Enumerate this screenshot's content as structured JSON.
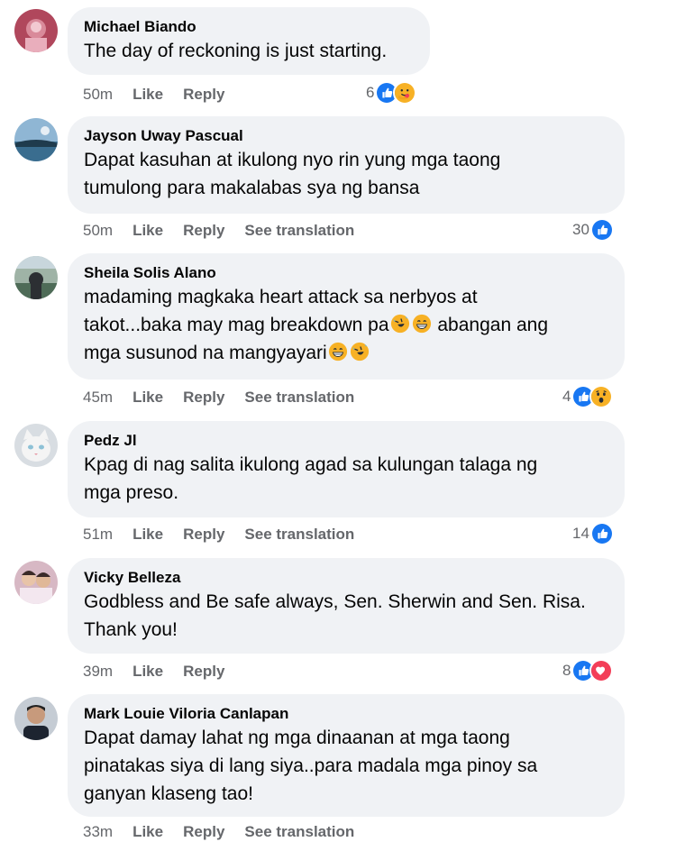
{
  "colors": {
    "bubble": "#f0f2f5",
    "meta_text": "#65676b",
    "like_blue": "#1877f2",
    "love_red": "#f33e58",
    "haha_yellow": "#f7b125"
  },
  "comments": [
    {
      "author": "Michael Biando",
      "text": "The day of reckoning is just starting.",
      "time": "50m",
      "like_label": "Like",
      "reply_label": "Reply",
      "reaction_count": "6",
      "reactions": [
        "like-icon",
        "care-icon"
      ]
    },
    {
      "author": "Jayson Uway Pascual",
      "line1": "Dapat kasuhan at ikulong nyo rin yung mga taong",
      "line2": "tumulong para makalabas sya ng bansa",
      "time": "50m",
      "like_label": "Like",
      "reply_label": "Reply",
      "translate_label": "See translation",
      "reaction_count": "30",
      "reactions": [
        "like-icon"
      ]
    },
    {
      "author": "Sheila Solis Alano",
      "line1": "madaming magkaka heart attack sa nerbyos at",
      "line2a": "takot...baka may mag breakdown pa",
      "line3a": "abangan ang",
      "line3b": "mga susunod na mangyayari",
      "time": "45m",
      "like_label": "Like",
      "reply_label": "Reply",
      "translate_label": "See translation",
      "reaction_count": "4",
      "reactions": [
        "like-icon",
        "wow-icon"
      ]
    },
    {
      "author": "Pedz Jl",
      "line1": "Kpag di nag salita ikulong agad sa kulungan talaga ng",
      "line2": "mga preso.",
      "time": "51m",
      "like_label": "Like",
      "reply_label": "Reply",
      "translate_label": "See translation",
      "reaction_count": "14",
      "reactions": [
        "like-icon"
      ]
    },
    {
      "author": "Vicky Belleza",
      "line1": "Godbless and Be safe always, Sen. Sherwin and Sen. Risa.",
      "line2": "Thank you!",
      "time": "39m",
      "like_label": "Like",
      "reply_label": "Reply",
      "reaction_count": "8",
      "reactions": [
        "like-icon",
        "love-icon"
      ]
    },
    {
      "author": "Mark Louie Viloria Canlapan",
      "line1": "Dapat damay lahat ng mga dinaanan at mga taong",
      "line2": "pinatakas siya di lang siya..para madala mga pinoy sa",
      "line3": "ganyan klaseng tao!",
      "time": "33m",
      "like_label": "Like",
      "reply_label": "Reply",
      "translate_label": "See translation"
    }
  ]
}
